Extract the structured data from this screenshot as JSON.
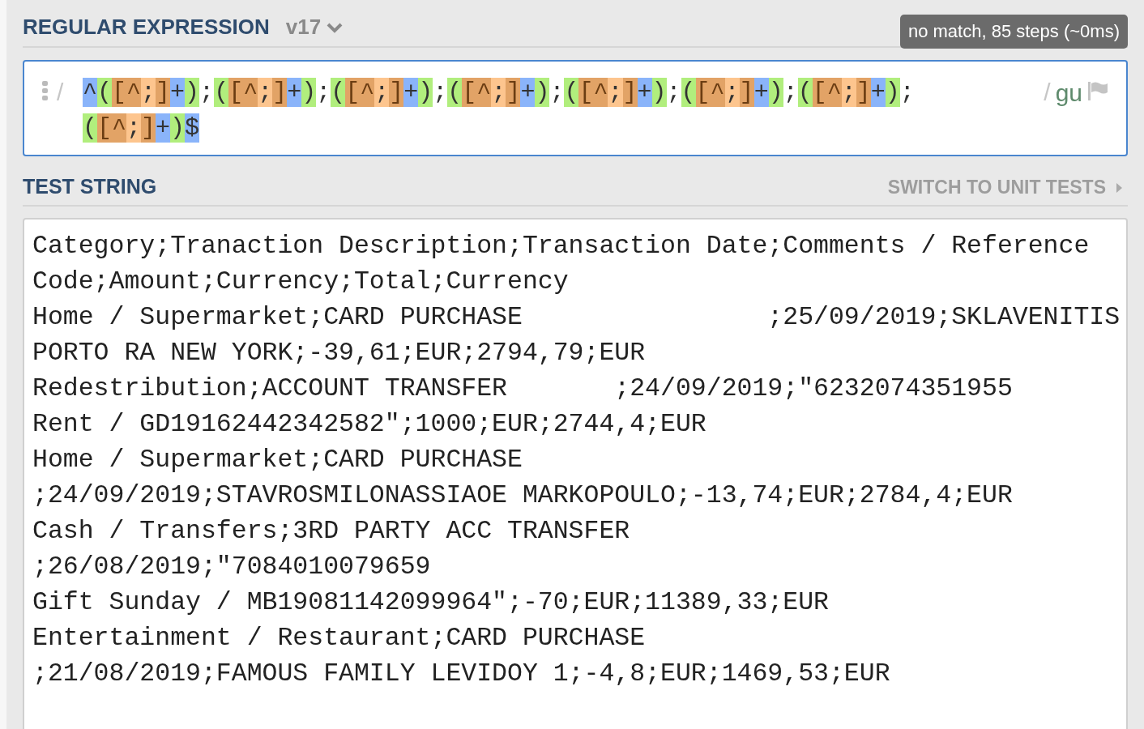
{
  "regex_panel": {
    "title": "REGULAR EXPRESSION",
    "version": "v17",
    "status": "no match, 85 steps (~0ms)",
    "delimiter_open": "/",
    "delimiter_close": "/",
    "flags": "gu",
    "lines": [
      [
        {
          "text": "^",
          "kind": "anchor"
        },
        {
          "text": "(",
          "kind": "group"
        },
        {
          "text": "[^",
          "kind": "set"
        },
        {
          "text": ";",
          "kind": "set-char"
        },
        {
          "text": "]",
          "kind": "set"
        },
        {
          "text": "+",
          "kind": "quantifier"
        },
        {
          "text": ")",
          "kind": "group"
        },
        {
          "text": ";",
          "kind": "literal"
        },
        {
          "text": "(",
          "kind": "group"
        },
        {
          "text": "[^",
          "kind": "set"
        },
        {
          "text": ";",
          "kind": "set-char"
        },
        {
          "text": "]",
          "kind": "set"
        },
        {
          "text": "+",
          "kind": "quantifier"
        },
        {
          "text": ")",
          "kind": "group"
        },
        {
          "text": ";",
          "kind": "literal"
        },
        {
          "text": "(",
          "kind": "group"
        },
        {
          "text": "[^",
          "kind": "set"
        },
        {
          "text": ";",
          "kind": "set-char"
        },
        {
          "text": "]",
          "kind": "set"
        },
        {
          "text": "+",
          "kind": "quantifier"
        },
        {
          "text": ")",
          "kind": "group"
        },
        {
          "text": ";",
          "kind": "literal"
        },
        {
          "text": "(",
          "kind": "group"
        },
        {
          "text": "[^",
          "kind": "set"
        },
        {
          "text": ";",
          "kind": "set-char"
        },
        {
          "text": "]",
          "kind": "set"
        },
        {
          "text": "+",
          "kind": "quantifier"
        },
        {
          "text": ")",
          "kind": "group"
        },
        {
          "text": ";",
          "kind": "literal"
        },
        {
          "text": "(",
          "kind": "group"
        },
        {
          "text": "[^",
          "kind": "set"
        },
        {
          "text": ";",
          "kind": "set-char"
        },
        {
          "text": "]",
          "kind": "set"
        },
        {
          "text": "+",
          "kind": "quantifier"
        },
        {
          "text": ")",
          "kind": "group"
        },
        {
          "text": ";",
          "kind": "literal"
        },
        {
          "text": "(",
          "kind": "group"
        },
        {
          "text": "[^",
          "kind": "set"
        },
        {
          "text": ";",
          "kind": "set-char"
        },
        {
          "text": "]",
          "kind": "set"
        },
        {
          "text": "+",
          "kind": "quantifier"
        },
        {
          "text": ")",
          "kind": "group"
        },
        {
          "text": ";",
          "kind": "literal"
        },
        {
          "text": "(",
          "kind": "group"
        },
        {
          "text": "[^",
          "kind": "set"
        },
        {
          "text": ";",
          "kind": "set-char"
        },
        {
          "text": "]",
          "kind": "set"
        },
        {
          "text": "+",
          "kind": "quantifier"
        },
        {
          "text": ")",
          "kind": "group"
        },
        {
          "text": ";",
          "kind": "literal"
        }
      ],
      [
        {
          "text": "(",
          "kind": "group"
        },
        {
          "text": "[^",
          "kind": "set"
        },
        {
          "text": ";",
          "kind": "set-char"
        },
        {
          "text": "]",
          "kind": "set"
        },
        {
          "text": "+",
          "kind": "quantifier"
        },
        {
          "text": ")",
          "kind": "group"
        },
        {
          "text": "$",
          "kind": "anchor"
        }
      ]
    ]
  },
  "test_panel": {
    "title": "TEST STRING",
    "switch_link": "SWITCH TO UNIT TESTS",
    "lines": [
      "Category;Tranaction Description;Transaction Date;Comments / Reference",
      "Code;Amount;Currency;Total;Currency",
      "Home / Supermarket;CARD PURCHASE                ;25/09/2019;SKLAVENITIS",
      "PORTO RA NEW YORK;-39,61;EUR;2794,79;EUR",
      "Redestribution;ACCOUNT TRANSFER       ;24/09/2019;\"6232074351955",
      "Rent / GD19162442342582\";1000;EUR;2744,4;EUR",
      "Home / Supermarket;CARD PURCHASE",
      ";24/09/2019;STAVROSMILONASSIAOE MARKOPOULO;-13,74;EUR;2784,4;EUR",
      "Cash / Transfers;3RD PARTY ACC TRANSFER",
      ";26/08/2019;\"7084010079659",
      "Gift Sunday / MB19081142099964\";-70;EUR;11389,33;EUR",
      "Entertainment / Restaurant;CARD PURCHASE",
      ";21/08/2019;FAMOUS FAMILY LEVIDOY 1;-4,8;EUR;1469,53;EUR"
    ]
  }
}
